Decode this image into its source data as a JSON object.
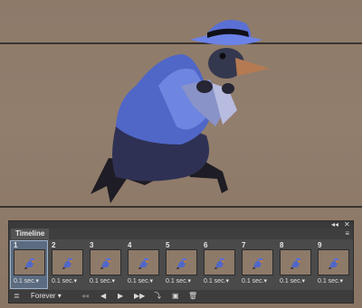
{
  "panel": {
    "title": "Timeline",
    "collapse_label": "◂◂",
    "close_label": "✕",
    "menu_icon": "≡"
  },
  "frames": [
    {
      "number": "1",
      "delay": "0.1 sec.▾"
    },
    {
      "number": "2",
      "delay": "0.1 sec.▾"
    },
    {
      "number": "3",
      "delay": "0.1 sec.▾"
    },
    {
      "number": "4",
      "delay": "0.1 sec.▾"
    },
    {
      "number": "5",
      "delay": "0.1 sec.▾"
    },
    {
      "number": "6",
      "delay": "0.1 sec.▾"
    },
    {
      "number": "7",
      "delay": "0.1 sec.▾"
    },
    {
      "number": "8",
      "delay": "0.1 sec.▾"
    },
    {
      "number": "9",
      "delay": "0.1 sec.▾"
    }
  ],
  "selected_frame": 1,
  "bottom_bar": {
    "loop_value": "Forever",
    "loop_caret": "▾",
    "icons": {
      "convert": "≣",
      "first_frame": "◂◂",
      "previous_frame": "◀",
      "play": "▶",
      "next_frame": "▶▶",
      "tween": "⤵",
      "duplicate": "▣",
      "delete": "🗑"
    }
  },
  "colors": {
    "panel_bg": "#4a4a4a",
    "selected_frame": "#5c6c80",
    "canvas_bg": "#8e7a69",
    "character_blue": "#5067c8",
    "character_dark": "#2a2c44"
  }
}
